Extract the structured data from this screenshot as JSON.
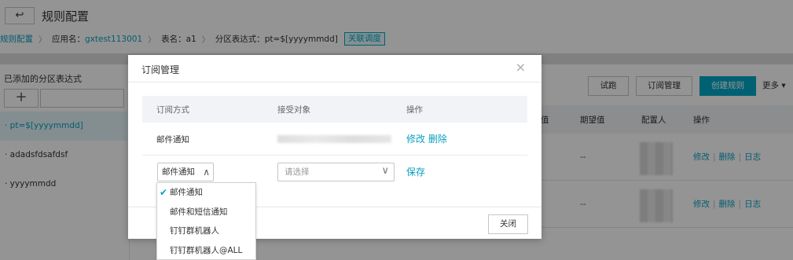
{
  "header": {
    "back_icon": "↩",
    "title": "规则配置"
  },
  "breadcrumb": {
    "root": "规则配置",
    "app_label": "应用名：",
    "app_value": "gxtest113001",
    "table_label": "表名：a1",
    "partition_label": "分区表达式：pt=$[yyyymmdd]",
    "associate_button": "关联调度"
  },
  "left_panel": {
    "title": "已添加的分区表达式",
    "add_icon": "+",
    "items": [
      "· pt=$[yyyymmdd]",
      "· adadsfdsafdsf",
      "· yyyymmdd"
    ]
  },
  "toolbar": {
    "trial_run": "试跑",
    "subscription": "订阅管理",
    "create_rule": "创建规则",
    "more": "更多 ▾"
  },
  "rules_table": {
    "headers": [
      "值",
      "期望值",
      "配置人",
      "操作"
    ],
    "rows": [
      {
        "expected": "--",
        "ops": [
          "修改",
          "删除",
          "日志"
        ]
      },
      {
        "expected": "--",
        "ops": [
          "修改",
          "删除",
          "日志"
        ]
      }
    ]
  },
  "modal": {
    "title": "订阅管理",
    "close_icon": "×",
    "headers": [
      "订阅方式",
      "接受对象",
      "操作"
    ],
    "rows": [
      {
        "method": "邮件通知",
        "ops": "修改 删除"
      }
    ],
    "edit_row": {
      "method_value": "邮件通知",
      "chevron_up": "∧",
      "target_placeholder": "请选择",
      "chevron_down": "∨",
      "save": "保存"
    },
    "close_button": "关闭"
  },
  "dropdown": {
    "options": [
      "邮件通知",
      "邮件和短信通知",
      "钉钉群机器人",
      "钉钉群机器人@ALL"
    ],
    "selected_index": 0,
    "check_icon": "✔"
  },
  "colors": {
    "accent": "#00a7c4",
    "link": "#0aa0bf"
  }
}
